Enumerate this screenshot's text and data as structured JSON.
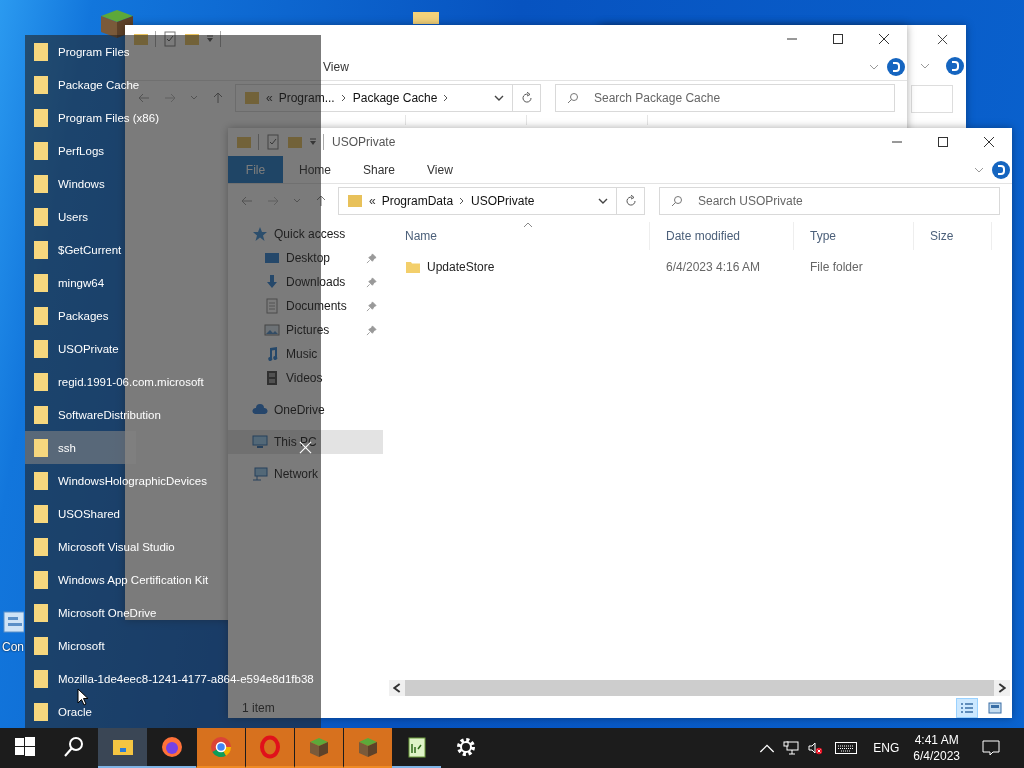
{
  "desktop": {
    "icons": [
      {
        "label": "Con"
      }
    ]
  },
  "back_window": {
    "ribbon_tabs": [
      {
        "label": "View"
      }
    ],
    "address": {
      "overflow": "«",
      "parts": [
        "Program...",
        "Package Cache"
      ]
    },
    "search": {
      "placeholder": "Search Package Cache"
    }
  },
  "front_window": {
    "title": "USOPrivate",
    "ribbon_tabs": [
      {
        "label": "File",
        "kind": "menu"
      },
      {
        "label": "Home",
        "kind": "tab"
      },
      {
        "label": "Share",
        "kind": "tab"
      },
      {
        "label": "View",
        "kind": "tab"
      }
    ],
    "address": {
      "overflow": "«",
      "parts": [
        "ProgramData",
        "USOPrivate"
      ]
    },
    "search": {
      "placeholder": "Search USOPrivate"
    },
    "nav": [
      {
        "label": "Quick access",
        "kind": "star",
        "selected": false,
        "children": [
          {
            "label": "Desktop",
            "kind": "desktop",
            "pinned": true,
            "selected": false
          },
          {
            "label": "Downloads",
            "kind": "download",
            "pinned": true,
            "selected": false
          },
          {
            "label": "Documents",
            "kind": "document",
            "pinned": true,
            "selected": false
          },
          {
            "label": "Pictures",
            "kind": "pictures",
            "pinned": true,
            "selected": false
          },
          {
            "label": "Music",
            "kind": "music",
            "pinned": false,
            "selected": false
          },
          {
            "label": "Videos",
            "kind": "videos",
            "pinned": false,
            "selected": false
          }
        ]
      },
      {
        "label": "OneDrive",
        "kind": "cloud",
        "selected": false
      },
      {
        "label": "This PC",
        "kind": "pc",
        "selected": true
      },
      {
        "label": "Network",
        "kind": "network",
        "selected": false
      }
    ],
    "columns": [
      "Name",
      "Date modified",
      "Type",
      "Size"
    ],
    "rows": [
      {
        "name": "UpdateStore",
        "date_modified": "6/4/2023 4:16 AM",
        "type": "File folder"
      }
    ],
    "status": "1 item",
    "view_buttons": [
      {
        "kind": "details",
        "selected": true
      },
      {
        "kind": "thumbnails",
        "selected": false
      }
    ]
  },
  "jump_list": {
    "items": [
      {
        "label": "Program Files",
        "selected": false
      },
      {
        "label": "Package Cache",
        "selected": false
      },
      {
        "label": "Program Files (x86)",
        "selected": false
      },
      {
        "label": "PerfLogs",
        "selected": false
      },
      {
        "label": "Windows",
        "selected": false
      },
      {
        "label": "Users",
        "selected": false
      },
      {
        "label": "$GetCurrent",
        "selected": false
      },
      {
        "label": "mingw64",
        "selected": false
      },
      {
        "label": "Packages",
        "selected": false
      },
      {
        "label": "USOPrivate",
        "selected": false
      },
      {
        "label": "regid.1991-06.com.microsoft",
        "selected": false
      },
      {
        "label": "SoftwareDistribution",
        "selected": false
      },
      {
        "label": "ssh",
        "selected": true
      },
      {
        "label": "WindowsHolographicDevices",
        "selected": false
      },
      {
        "label": "USOShared",
        "selected": false
      },
      {
        "label": "Microsoft Visual Studio",
        "selected": false
      },
      {
        "label": "Windows App Certification Kit",
        "selected": false
      },
      {
        "label": "Microsoft OneDrive",
        "selected": false
      },
      {
        "label": "Microsoft",
        "selected": false
      },
      {
        "label": "Mozilla-1de4eec8-1241-4177-a864-e594e8d1fb38",
        "selected": false
      },
      {
        "label": "Oracle",
        "selected": false
      }
    ]
  },
  "taskbar": {
    "apps": [
      {
        "kind": "start",
        "open": false,
        "active": false,
        "flashing": false
      },
      {
        "kind": "search",
        "open": false,
        "active": false,
        "flashing": false
      },
      {
        "kind": "explorer",
        "open": true,
        "active": true,
        "flashing": false
      },
      {
        "kind": "firefox",
        "open": true,
        "active": false,
        "flashing": false
      },
      {
        "kind": "chrome",
        "open": true,
        "active": false,
        "flashing": true
      },
      {
        "kind": "opera",
        "open": true,
        "active": false,
        "flashing": true
      },
      {
        "kind": "minecraft",
        "open": true,
        "active": false,
        "flashing": true
      },
      {
        "kind": "minecraft",
        "open": true,
        "active": false,
        "flashing": true
      },
      {
        "kind": "editor",
        "open": true,
        "active": false,
        "flashing": false
      },
      {
        "kind": "settings",
        "open": false,
        "active": false,
        "flashing": false
      }
    ],
    "tray": {
      "volume_muted": true,
      "language": "ENG",
      "time": "4:41 AM",
      "date": "6/4/2023"
    }
  }
}
